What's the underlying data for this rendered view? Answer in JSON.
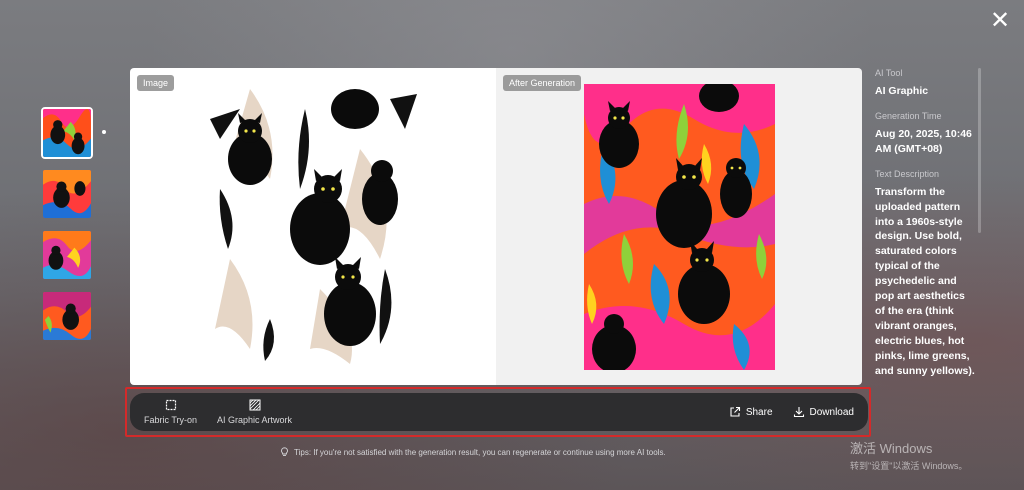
{
  "close_icon": "close-icon",
  "thumbnails": [
    {
      "name": "thumb-1",
      "active": true
    },
    {
      "name": "thumb-2",
      "active": false
    },
    {
      "name": "thumb-3",
      "active": false
    },
    {
      "name": "thumb-4",
      "active": false
    }
  ],
  "compare": {
    "left_tag": "Image",
    "right_tag": "After Generation"
  },
  "info": {
    "tool_label": "AI Tool",
    "tool_value": "AI Graphic",
    "time_label": "Generation Time",
    "time_value": "Aug 20, 2025, 10:46 AM (GMT+08)",
    "desc_label": "Text Description",
    "desc_value": "Transform the uploaded pattern into a 1960s-style design. Use bold, saturated colors typical of the psychedelic and pop art aesthetics of the era (think vibrant oranges, electric blues, hot pinks, lime greens, and sunny yellows)."
  },
  "toolbar": {
    "fabric_tryon": "Fabric Try-on",
    "graphic_artwork": "AI Graphic Artwork",
    "share": "Share",
    "download": "Download"
  },
  "tips": "Tips: If you're not satisfied with the generation result, you can regenerate or continue using more AI tools.",
  "watermark": {
    "line1": "激活 Windows",
    "line2": "转到\"设置\"以激活 Windows。"
  },
  "colors": {
    "highlight": "#d42a2a",
    "toolbar_bg": "#2d2d2f",
    "palette": [
      "#ff4f1a",
      "#1f8fd6",
      "#ff2f8a",
      "#8fd13a",
      "#ffd21f",
      "#111111"
    ]
  }
}
